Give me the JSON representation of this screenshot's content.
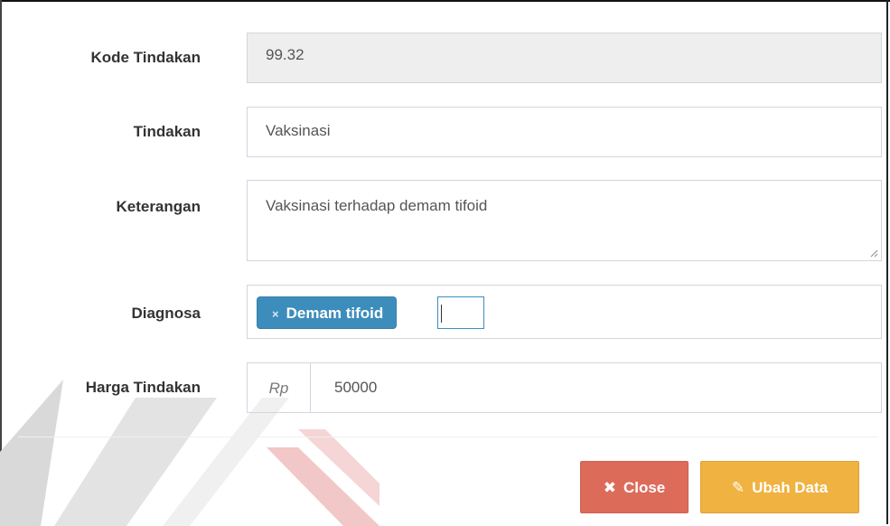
{
  "form": {
    "kode": {
      "label": "Kode Tindakan",
      "value": "99.32"
    },
    "tindakan": {
      "label": "Tindakan",
      "value": "Vaksinasi"
    },
    "keterangan": {
      "label": "Keterangan",
      "value": "Vaksinasi terhadap demam tifoid"
    },
    "diagnosa": {
      "label": "Diagnosa",
      "tags": [
        {
          "remove": "×",
          "text": "Demam tifoid"
        }
      ]
    },
    "harga": {
      "label": "Harga Tindakan",
      "prefix": "Rp",
      "value": "50000"
    }
  },
  "buttons": {
    "close": {
      "icon": "✖",
      "icon_name": "close-icon",
      "label": "Close"
    },
    "edit": {
      "icon": "✎",
      "icon_name": "edit-icon",
      "label": "Ubah Data"
    }
  },
  "colors": {
    "tag": "#3c8dbc",
    "close": "#dd6b5a",
    "edit": "#f0b240",
    "readonly_bg": "#eeeeee"
  }
}
